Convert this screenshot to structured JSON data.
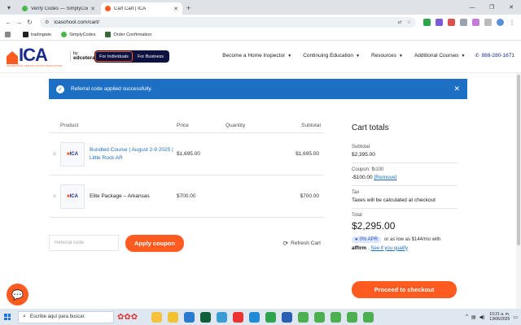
{
  "browser": {
    "tabs": [
      {
        "title": "Verify Codes — SimplyCodes",
        "active": false,
        "favicon_color": "#49b84a"
      },
      {
        "title": "Cart Cart | ICA",
        "active": true,
        "favicon_color": "#ff5a1f"
      }
    ],
    "new_tab_label": "+",
    "url": "icaschool.com/cart/",
    "bookmarks": [
      {
        "label": "tradingwie",
        "icon_color": "#222"
      },
      {
        "label": "SimplyCodes",
        "icon_color": "#49b84a"
      },
      {
        "label": "Order Confirmation",
        "icon_color": "#3a6a3a"
      }
    ]
  },
  "site": {
    "logo_text": "ICA",
    "logo_subtext": "INSPECTION CERTIFICATION ASSOCIATES",
    "by_label": "by",
    "by_brand": "edcetera",
    "audience": [
      "For Individuals",
      "For Business"
    ],
    "nav": [
      "Become a Home Inspector",
      "Continuing Education",
      "Resources",
      "Additional Courses"
    ],
    "phone": "888-280-1671"
  },
  "notice": {
    "message": "Referral code applied successfully."
  },
  "cart": {
    "headers": [
      "Product",
      "Price",
      "Quantity",
      "Subtotal"
    ],
    "rows": [
      {
        "name": "Bundled Course | August 2-9 2025 | Little Rock AR",
        "price": "$1,695.00",
        "subtotal": "$1,695.00",
        "linked": true
      },
      {
        "name": "Elite Package – Arkansas",
        "price": "$700.00",
        "subtotal": "$700.00",
        "linked": false
      }
    ],
    "coupon_placeholder": "Referral code",
    "apply_label": "Apply coupon",
    "refresh_label": "Refresh Cart"
  },
  "totals": {
    "title": "Cart totals",
    "subtotal_label": "Subtotal",
    "subtotal_value": "$2,395.00",
    "coupon_label": "Coupon: fb100",
    "coupon_value": "-$100.00",
    "remove_label": "[Remove]",
    "tax_label": "Tax",
    "tax_value": "Taxes will be calculated at checkout",
    "total_label": "Total",
    "total_value": "$2,295.00",
    "apr_badge": "0% APR",
    "apr_text": "or as low as $144/mo with",
    "affirm_brand": "affirm",
    "prequalify_label": "See if you qualify",
    "checkout_label": "Proceed to checkout"
  },
  "taskbar": {
    "search_placeholder": "Escribe aquí para buscar.",
    "time": "10:21 a. m.",
    "date": "13/06/2025",
    "app_colors": [
      "#f6c13d",
      "#f1c232",
      "#2a7ad1",
      "#0f5f3a",
      "#3b9cd6",
      "#e33",
      "#1f8ad8",
      "#2ea44f",
      "#2b5fb3",
      "#4caf50",
      "#4caf50",
      "#4caf50",
      "#4caf50",
      "#4caf50"
    ]
  }
}
